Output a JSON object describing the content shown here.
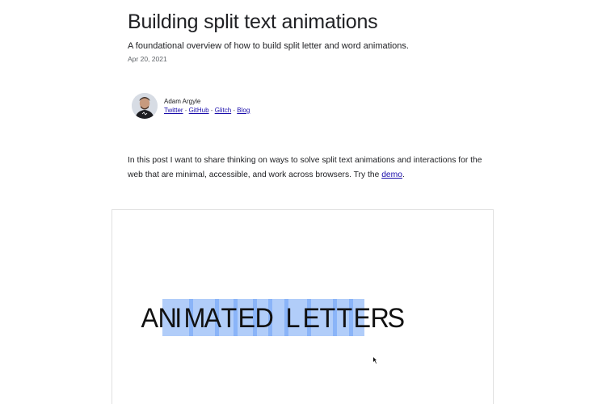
{
  "article": {
    "title": "Building split text animations",
    "subtitle": "A foundational overview of how to build split letter and word animations.",
    "date": "Apr 20, 2021"
  },
  "author": {
    "name": "Adam Argyle",
    "links": [
      {
        "label": "Twitter"
      },
      {
        "label": "GitHub"
      },
      {
        "label": "Glitch"
      },
      {
        "label": "Blog"
      }
    ],
    "separator": " - "
  },
  "intro": {
    "text_before": "In this post I want to share thinking on ways to solve split text animations and interactions for the web that are minimal, accessible, and work across browsers. Try the ",
    "link_label": "demo",
    "text_after": "."
  },
  "demo": {
    "letters": [
      "A",
      "N",
      "I",
      "M",
      "A",
      "T",
      "E",
      "D",
      " ",
      "L",
      "E",
      "T",
      "T",
      "E",
      "R",
      "S"
    ],
    "highlight_color": "#a8c8f8",
    "stripe_color": "#8ab4f8"
  },
  "colors": {
    "link": "#1a0dab",
    "text": "#202124",
    "muted": "#5f6368"
  }
}
